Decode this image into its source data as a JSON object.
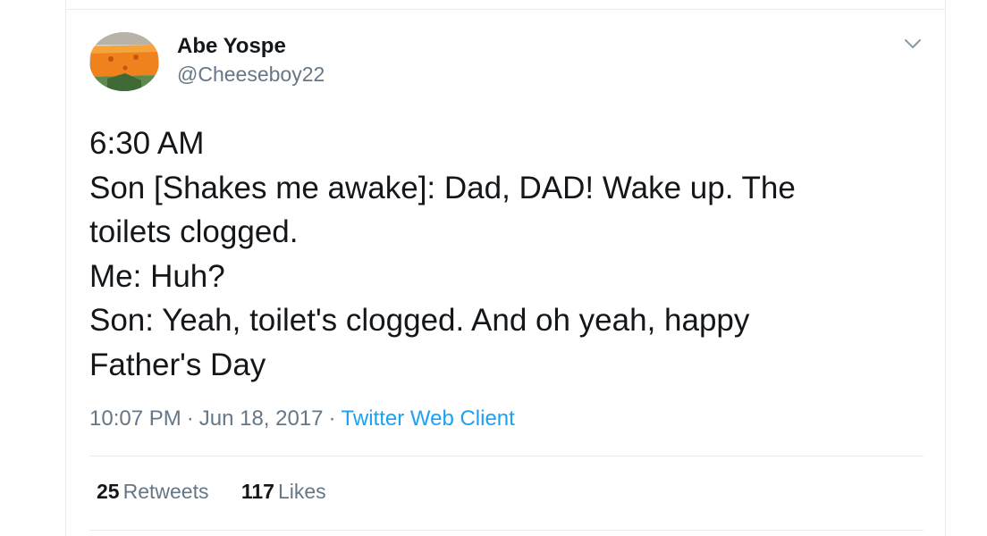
{
  "tweet": {
    "author": {
      "display_name": "Abe Yospe",
      "handle": "@Cheeseboy22",
      "avatar_icon": "cheese-avatar"
    },
    "menu_icon": "chevron-down-icon",
    "text_lines": [
      "6:30 AM",
      "Son [Shakes me awake]: Dad, DAD! Wake up. The",
      "toilets clogged.",
      "Me: Huh?",
      "Son: Yeah, toilet's clogged. And oh yeah, happy",
      "Father's Day"
    ],
    "time": "10:07 PM",
    "separator": "·",
    "date": "Jun 18, 2017",
    "source": "Twitter Web Client",
    "stats": {
      "retweets_count": "25",
      "retweets_label": "Retweets",
      "likes_count": "117",
      "likes_label": "Likes"
    }
  },
  "colors": {
    "text": "#14171a",
    "secondary": "#657786",
    "link": "#1da1f2",
    "divider": "#e6ecf0"
  }
}
